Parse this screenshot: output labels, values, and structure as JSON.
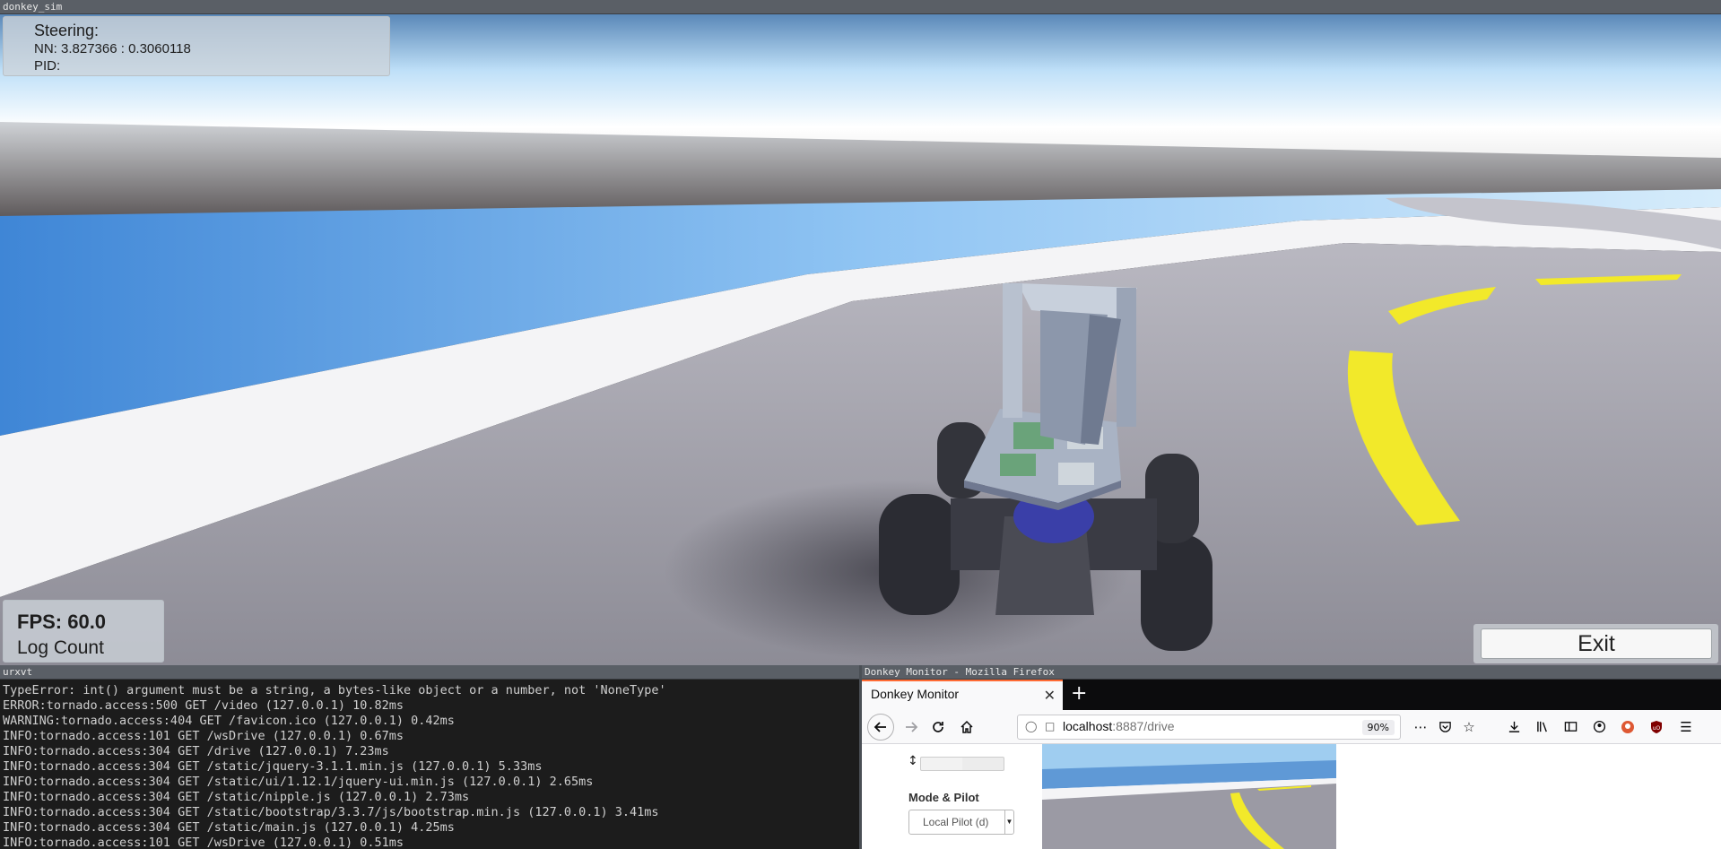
{
  "sim": {
    "window_title": "donkey_sim",
    "steering_title": "Steering:",
    "nn_label": "NN: 3.827366 : 0.3060118",
    "pid_label": "PID:",
    "fps_label": "FPS: 60.0",
    "log_count_label": "Log Count",
    "exit_label": "Exit"
  },
  "terminal": {
    "window_title": "urxvt",
    "lines": [
      "TypeError: int() argument must be a string, a bytes-like object or a number, not 'NoneType'",
      "ERROR:tornado.access:500 GET /video (127.0.0.1) 10.82ms",
      "WARNING:tornado.access:404 GET /favicon.ico (127.0.0.1) 0.42ms",
      "INFO:tornado.access:101 GET /wsDrive (127.0.0.1) 0.67ms",
      "INFO:tornado.access:304 GET /drive (127.0.0.1) 7.23ms",
      "INFO:tornado.access:304 GET /static/jquery-3.1.1.min.js (127.0.0.1) 5.33ms",
      "INFO:tornado.access:304 GET /static/ui/1.12.1/jquery-ui.min.js (127.0.0.1) 2.65ms",
      "INFO:tornado.access:304 GET /static/nipple.js (127.0.0.1) 2.73ms",
      "INFO:tornado.access:304 GET /static/bootstrap/3.3.7/js/bootstrap.min.js (127.0.0.1) 3.41ms",
      "INFO:tornado.access:304 GET /static/main.js (127.0.0.1) 4.25ms",
      "INFO:tornado.access:101 GET /wsDrive (127.0.0.1) 0.51ms"
    ]
  },
  "firefox": {
    "window_title": "Donkey Monitor - Mozilla Firefox",
    "tab_title": "Donkey Monitor",
    "tab_close": "✕",
    "new_tab": "+",
    "url_host": "localhost",
    "url_path": ":8887/drive",
    "zoom": "90%",
    "page": {
      "slider_glyph": "↕",
      "mode_label": "Mode & Pilot",
      "mode_value": "Local Pilot (d)"
    }
  },
  "colors": {
    "accent_tab": "#ff6a33",
    "road_marking": "#f2e92a",
    "sky": "#7fb8ec"
  }
}
